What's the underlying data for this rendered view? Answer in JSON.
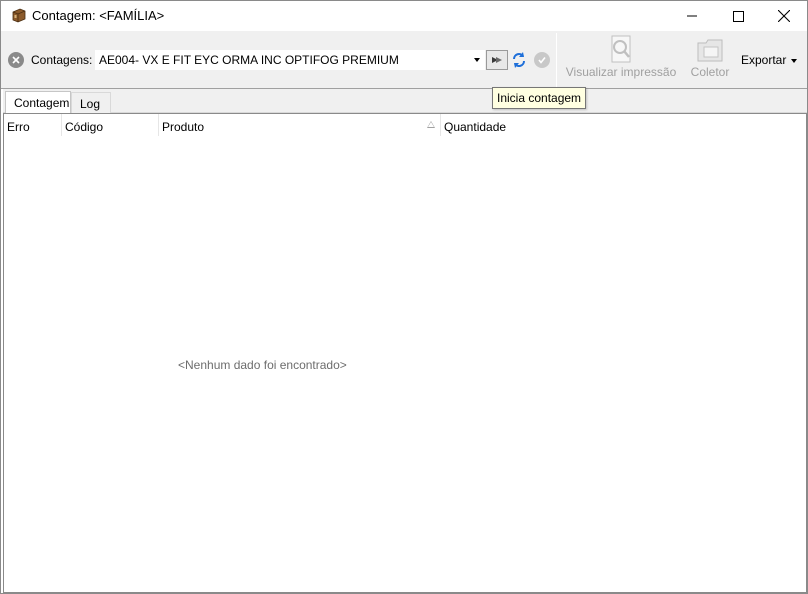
{
  "window": {
    "title": "Contagem: <FAMÍLIA>",
    "icon": "archive-box-icon"
  },
  "toolbar": {
    "contagens_label": "Contagens:",
    "contagens_value": "AE004- VX E FIT EYC ORMA INC OPTIFOG PREMIUM",
    "preview_label": "Visualizar impressão",
    "coletor_label": "Coletor",
    "export_label": "Exportar",
    "tooltip": "Inicia contagem"
  },
  "tabs": [
    {
      "label": "Contagem",
      "active": true
    },
    {
      "label": "Log",
      "active": false
    }
  ],
  "grid": {
    "columns": [
      "Erro",
      "Código",
      "Produto",
      "Quantidade"
    ],
    "sort_column": "Produto",
    "empty_message": "<Nenhum dado foi encontrado>"
  },
  "colors": {
    "toolbar_bg": "#f0f0f0",
    "tooltip_bg": "#ffffe1",
    "disabled_text": "#a0a0a0",
    "refresh_blue": "#1e6fd9"
  }
}
